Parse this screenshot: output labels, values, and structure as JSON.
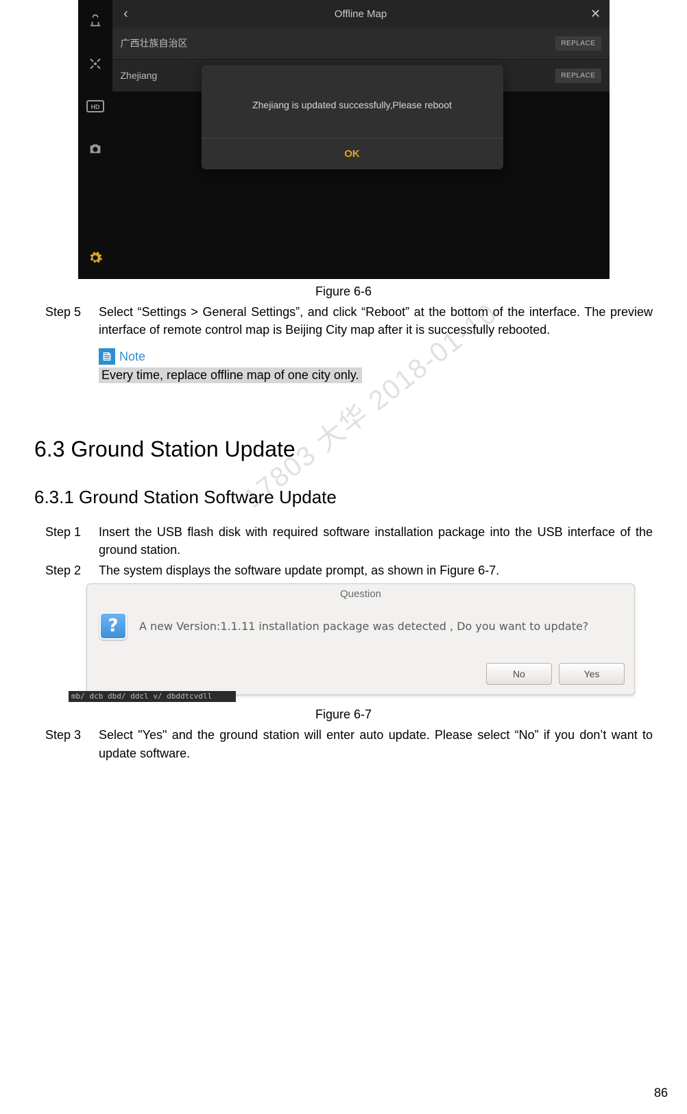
{
  "fig66": {
    "header": {
      "title": "Offline Map"
    },
    "rows": [
      {
        "name": "广西壮族自治区",
        "button": "REPLACE"
      },
      {
        "name": "Zhejiang",
        "button": "REPLACE"
      }
    ],
    "modal": {
      "message": "Zhejiang is updated successfully,Please reboot",
      "ok": "OK"
    }
  },
  "fig66_caption": "Figure 6-6",
  "step5": {
    "label": "Step 5",
    "text": "Select “Settings > General Settings”, and click “Reboot” at the bottom of the interface. The preview interface of remote control map is Beijing City map after it is successfully rebooted."
  },
  "note": {
    "label": "Note",
    "text": "Every time, replace offline map of one city only."
  },
  "watermark": "17803 大华 2018-01-10",
  "section": {
    "h2": "6.3  Ground Station Update",
    "h3": "6.3.1    Ground Station Software Update"
  },
  "step1": {
    "label": "Step 1",
    "text": "Insert the USB flash disk with required software installation package into the USB interface of the ground station."
  },
  "step2": {
    "label": "Step 2",
    "text": "The system displays the software update prompt, as shown in Figure 6-7."
  },
  "fig67": {
    "title": "Question",
    "message": "A new Version:1.1.11 installation package was detected , Do you want to update?",
    "no": "No",
    "yes": "Yes",
    "strip": "mb/ dcb  dbd/ ddcl   v/ dbddtcvdll"
  },
  "fig67_caption": "Figure 6-7",
  "step3": {
    "label": "Step 3",
    "text": "Select \"Yes\" and the ground station will enter auto update. Please select “No” if you don’t want to update software."
  },
  "page_number": "86"
}
